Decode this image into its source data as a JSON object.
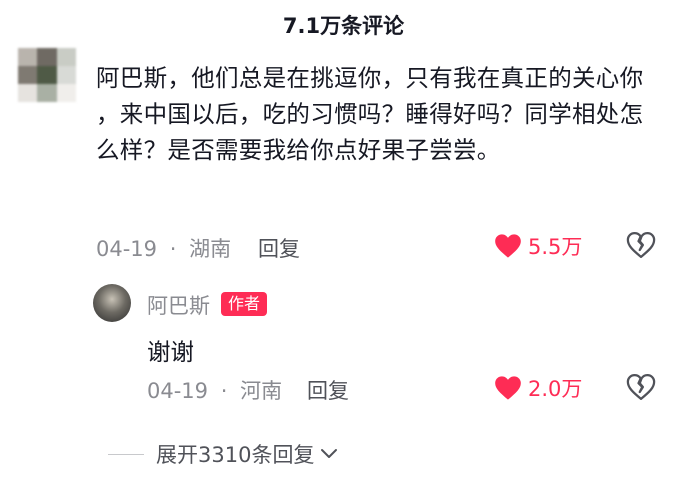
{
  "header": {
    "comment_count_label": "7.1万条评论"
  },
  "comment": {
    "text": "阿巴斯，他们总是在挑逗你，只有我在真正的关心你 ，来中国以后，吃的习惯吗？睡得好吗？同学相处怎么样？是否需要我给你点好果子尝尝。",
    "date": "04-19",
    "separator": "·",
    "location": "湖南",
    "reply_label": "回复",
    "likes": "5.5万"
  },
  "reply": {
    "username": "阿巴斯",
    "author_badge": "作者",
    "text": "谢谢",
    "date": "04-19",
    "separator": "·",
    "location": "河南",
    "reply_label": "回复",
    "likes": "2.0万"
  },
  "expand_replies_label": "展开3310条回复",
  "colors": {
    "accent": "#fe2c55",
    "text": "#161823",
    "meta": "#8a8b91"
  }
}
